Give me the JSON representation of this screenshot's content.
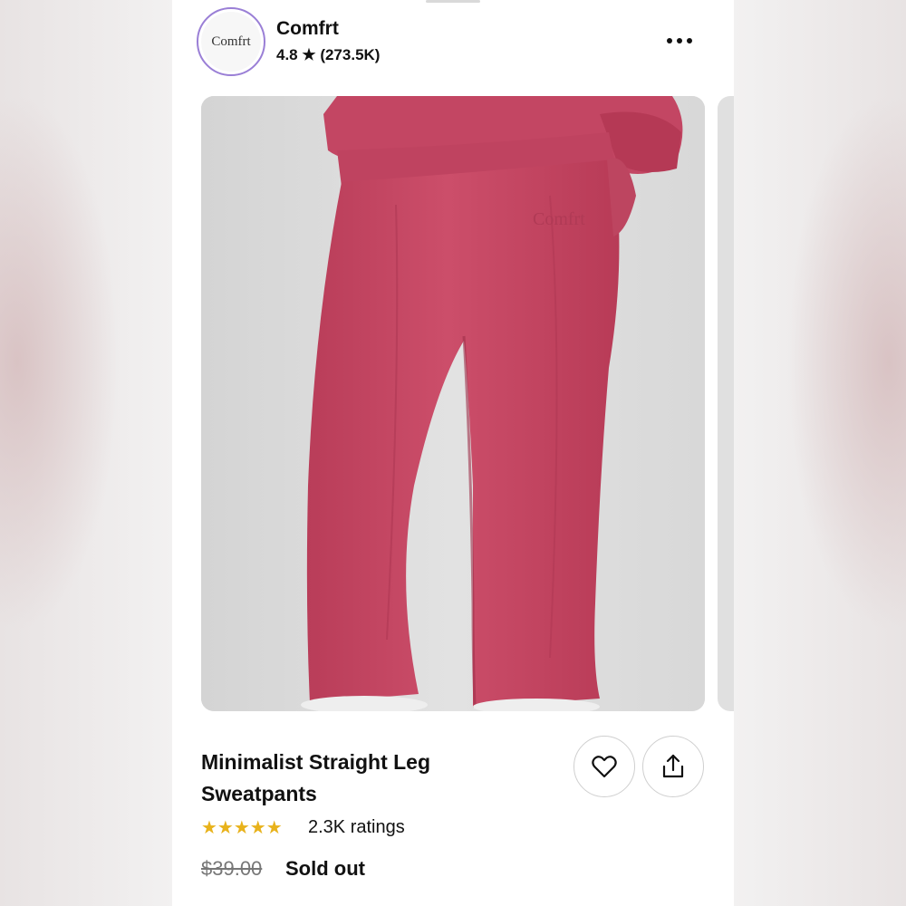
{
  "shop": {
    "logo_text": "Comfrt",
    "name": "Comfrt",
    "rating": "4.8 ★ (273.5K)"
  },
  "product": {
    "title": "Minimalist Straight Leg Sweatpants",
    "stars": "★★★★★",
    "ratings": "2.3K ratings",
    "old_price": "$39.00",
    "status": "Sold out",
    "image_logo_text": "Comfrt"
  },
  "icons": {
    "more": "more-horizontal-icon",
    "favorite": "heart-icon",
    "share": "share-icon"
  },
  "colors": {
    "garment": "#c84a66",
    "star": "#e8b21b",
    "logo_ring": "#9a7fd6"
  }
}
